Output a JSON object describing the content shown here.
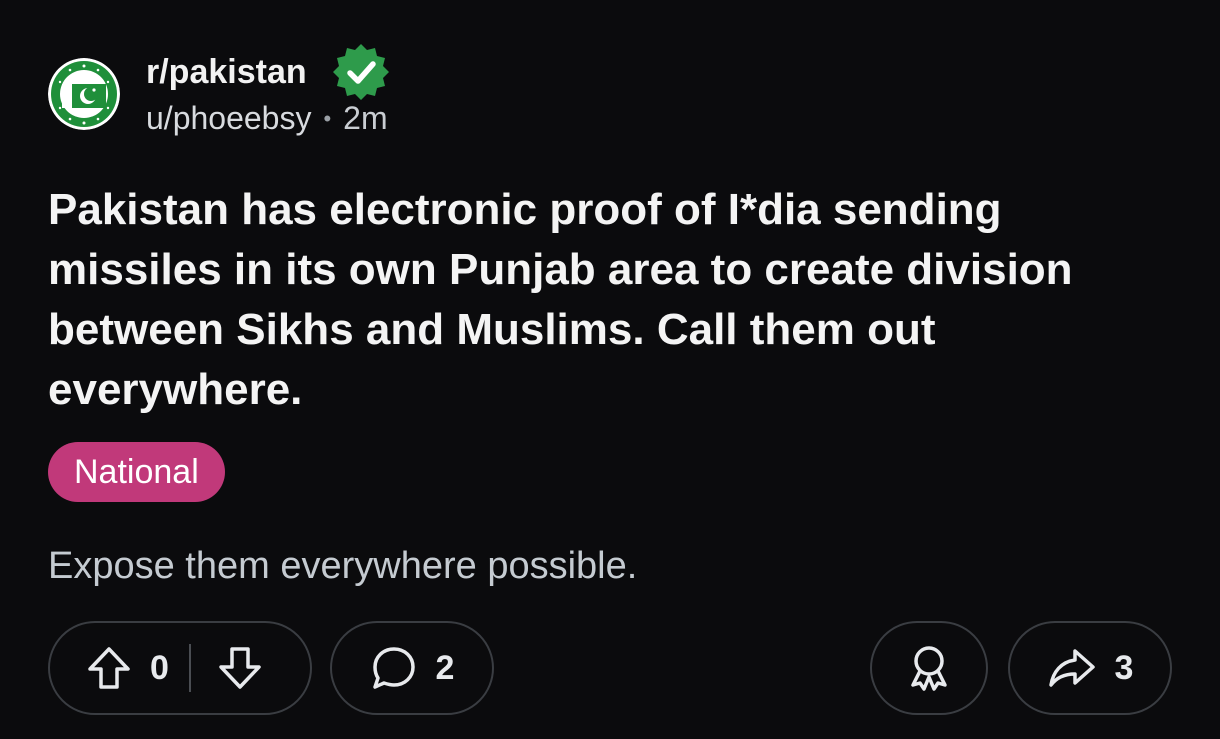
{
  "post": {
    "subreddit": "r/pakistan",
    "author": "u/phoeebsy",
    "time_ago": "2m",
    "title": "Pakistan has electronic proof of I*dia sending missiles in its own Punjab area to create division between Sikhs and Muslims. Call them out everywhere.",
    "flair": "National",
    "body": "Expose them everywhere possible."
  },
  "actions": {
    "vote_count": "0",
    "comment_count": "2",
    "share_count": "3"
  },
  "icons": {
    "verified": "verified-badge-icon",
    "upvote": "upvote-arrow-icon",
    "downvote": "downvote-arrow-icon",
    "comment": "comment-bubble-icon",
    "award": "award-ribbon-icon",
    "share": "share-arrow-icon"
  },
  "colors": {
    "background": "#0b0b0d",
    "flair": "#c1397a",
    "verified": "#2e9b4b",
    "avatar_green": "#1f8f3a"
  }
}
